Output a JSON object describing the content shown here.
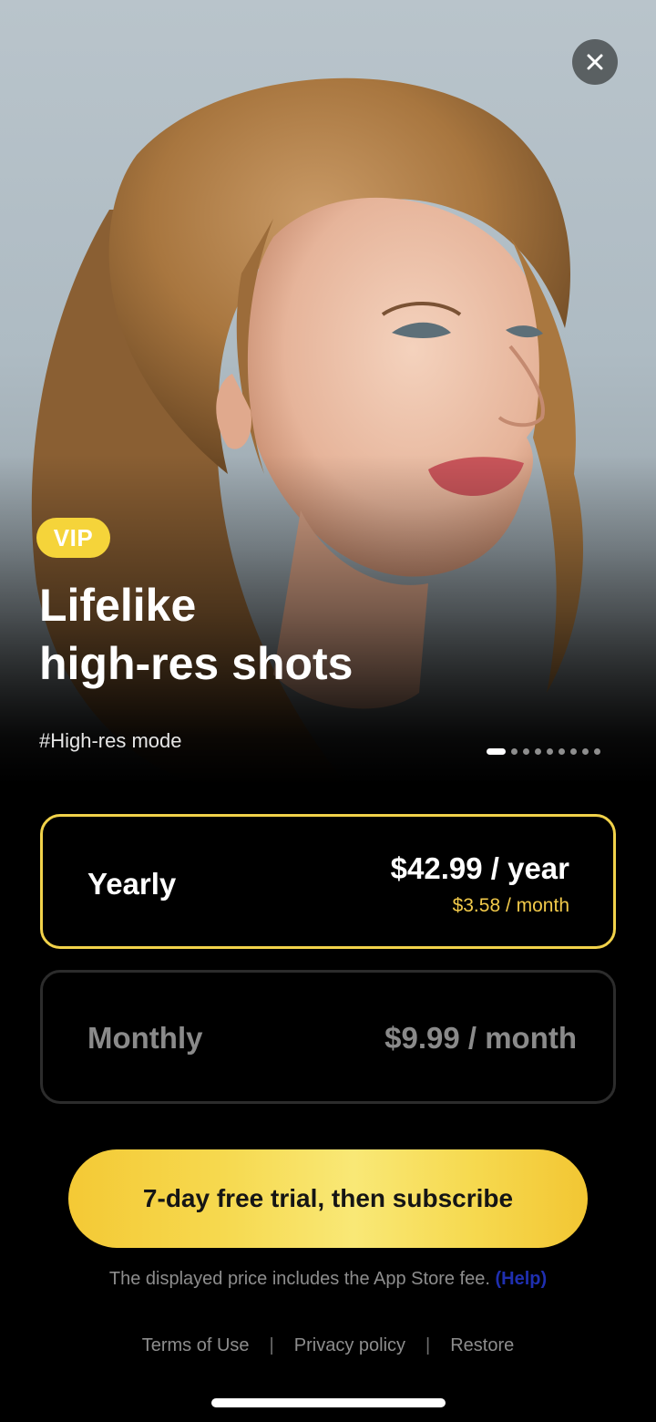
{
  "hero": {
    "badge": "VIP",
    "title_line1": "Lifelike",
    "title_line2": "high-res shots",
    "tag": "#High-res mode",
    "carousel": {
      "page_count": 9,
      "active_index": 0
    }
  },
  "close": {
    "icon": "close-icon"
  },
  "plans": [
    {
      "name": "Yearly",
      "price": "$42.99 / year",
      "per_month": "$3.58 / month",
      "selected": true
    },
    {
      "name": "Monthly",
      "price": "$9.99 / month",
      "selected": false
    }
  ],
  "cta": {
    "label": "7-day free trial, then subscribe"
  },
  "fee_note": {
    "text": "The displayed price includes the App Store fee.",
    "help": "(Help)"
  },
  "footer": {
    "links": [
      "Terms of Use",
      "Privacy policy",
      "Restore"
    ],
    "separator": "|"
  },
  "colors": {
    "accent": "#f5d43a",
    "selected_border": "#f1d24a",
    "unselected_border": "#2c2c2c",
    "background": "#000000",
    "help_link": "#1f2fb0"
  }
}
